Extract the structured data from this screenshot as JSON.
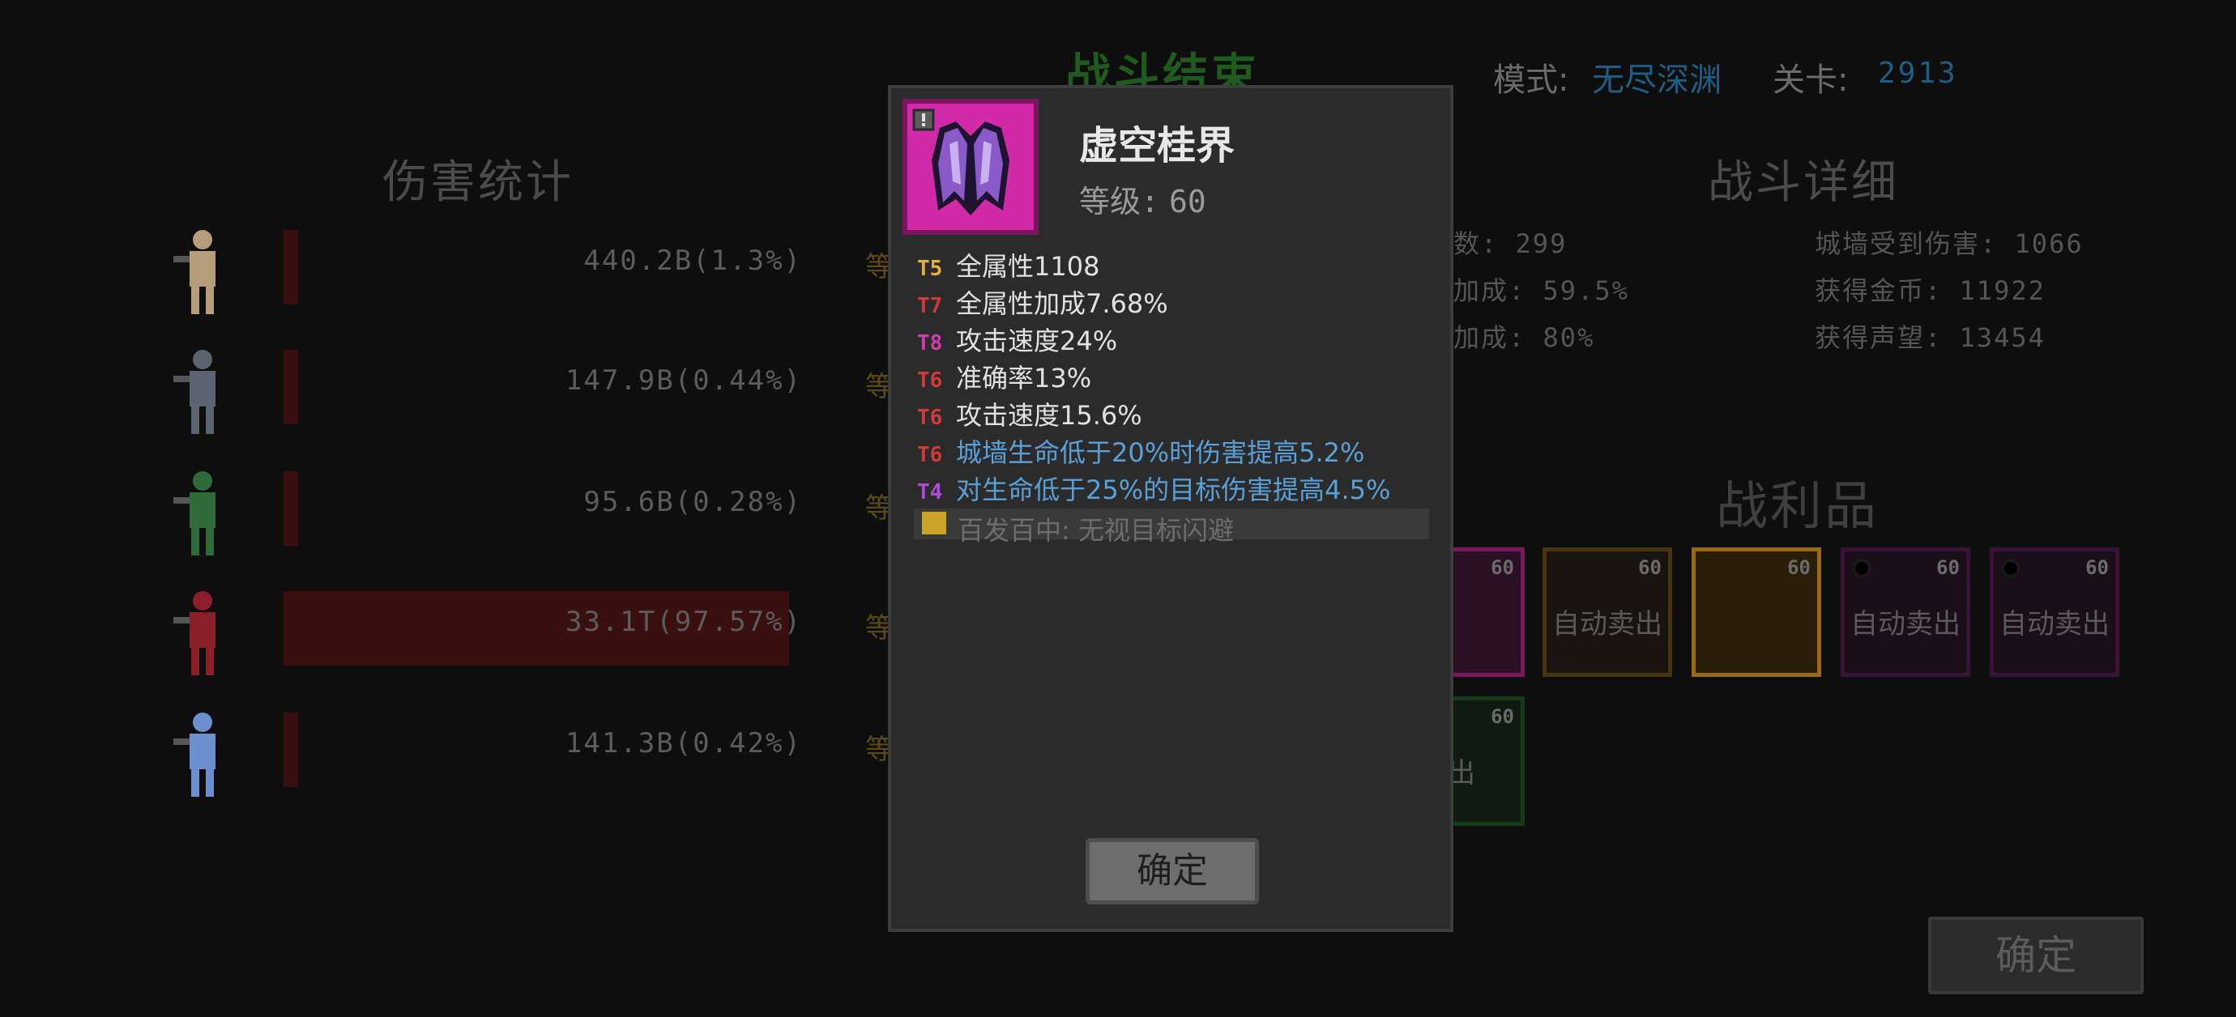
{
  "header": {
    "result_title": "战斗结束",
    "mode_label": "模式:",
    "mode_value": "无尽深渊",
    "stage_label": "关卡:",
    "stage_value": "2913"
  },
  "damage": {
    "title": "伤害统计",
    "rows": [
      {
        "value": "440.2B(1.3%)",
        "extra": "等",
        "share": 1.3,
        "hero_color": "#b59c7a"
      },
      {
        "value": "147.9B(0.44%)",
        "extra": "等",
        "share": 0.44,
        "hero_color": "#5b6470"
      },
      {
        "value": "95.6B(0.28%)",
        "extra": "等",
        "share": 0.28,
        "hero_color": "#2f6a3a"
      },
      {
        "value": "33.1T(97.57%)",
        "extra": "等",
        "share": 97.57,
        "hero_color": "#8a1f2a"
      },
      {
        "value": "141.3B(0.42%)",
        "extra": "等",
        "share": 0.42,
        "hero_color": "#6c8fd0"
      }
    ]
  },
  "details": {
    "title": "战斗详细",
    "left": [
      "数: 299",
      "加成: 59.5%",
      "加成: 80%"
    ],
    "right": [
      "城墙受到伤害: 1066",
      "获得金币: 11922",
      "获得声望: 13454"
    ]
  },
  "loot": {
    "title": "战利品",
    "items": [
      {
        "level": "60",
        "text": "",
        "border": "#7a1560",
        "bg": "#2a0f25"
      },
      {
        "level": "60",
        "text": "自动卖出",
        "border": "#4a3512",
        "bg": "#1a1410"
      },
      {
        "level": "60",
        "text": "",
        "border": "#9a6a12",
        "bg": "#2a1d0a"
      },
      {
        "level": "60",
        "text": "自动卖出",
        "border": "#3a1235",
        "bg": "#1a0f18"
      },
      {
        "level": "60",
        "text": "自动卖出",
        "border": "#3a1235",
        "bg": "#1a0f18"
      },
      {
        "level": "60",
        "text": "卖出",
        "border": "#143a1a",
        "bg": "#0f1a10"
      }
    ]
  },
  "confirm_main": "确定",
  "dialog": {
    "item_name": "虚空桂界",
    "level_label": "等级:",
    "level_value": "60",
    "affixes": [
      {
        "tier": "T5",
        "tier_color": "#e0b23a",
        "text": "全属性1108",
        "blue": false
      },
      {
        "tier": "T7",
        "tier_color": "#d23a3a",
        "text": "全属性加成7.68%",
        "blue": false
      },
      {
        "tier": "T8",
        "tier_color": "#d23ab0",
        "text": "攻击速度24%",
        "blue": false
      },
      {
        "tier": "T6",
        "tier_color": "#d23a3a",
        "text": "准确率13%",
        "blue": false
      },
      {
        "tier": "T6",
        "tier_color": "#d23a3a",
        "text": "攻击速度15.6%",
        "blue": false
      },
      {
        "tier": "T6",
        "tier_color": "#d23a3a",
        "text": "城墙生命低于20%时伤害提高5.2%",
        "blue": true
      },
      {
        "tier": "T4",
        "tier_color": "#b04ad8",
        "text": "对生命低于25%的目标伤害提高4.5%",
        "blue": true
      }
    ],
    "set_text": "百发百中: 无视目标闪避",
    "confirm": "确定"
  }
}
